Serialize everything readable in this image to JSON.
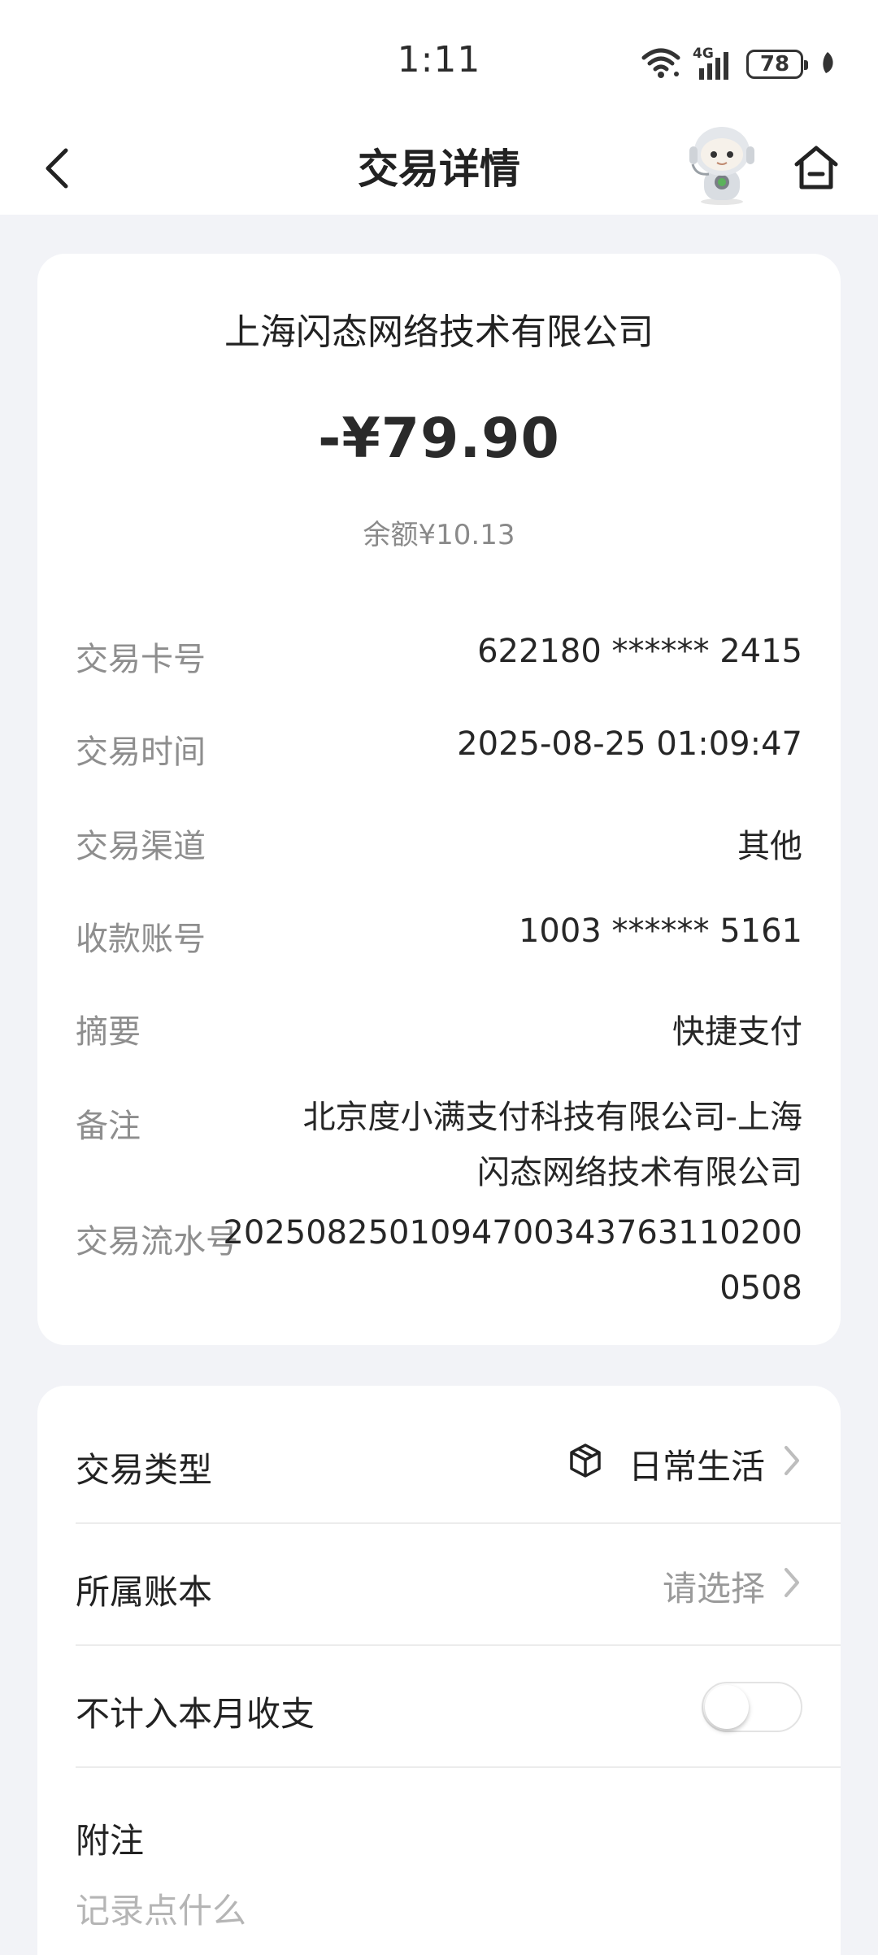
{
  "status_bar": {
    "time": "1:11",
    "network": "4G",
    "battery": "78"
  },
  "header": {
    "title": "交易详情"
  },
  "transaction": {
    "merchant": "上海闪态网络技术有限公司",
    "amount": "-¥79.90",
    "balance": "余额¥10.13",
    "details": [
      {
        "label": "交易卡号",
        "value": "622180 ****** 2415"
      },
      {
        "label": "交易时间",
        "value": "2025-08-25 01:09:47"
      },
      {
        "label": "交易渠道",
        "value": "其他"
      },
      {
        "label": "收款账号",
        "value": "1003 ****** 5161"
      },
      {
        "label": "摘要",
        "value": "快捷支付"
      },
      {
        "label": "备注",
        "value_line1": "北京度小满支付科技有限公司-上海",
        "value_line2": "闪态网络技术有限公司"
      },
      {
        "label": "交易流水号",
        "value_line1": "2025082501094700343763110200",
        "value_line2": "0508"
      }
    ]
  },
  "settings": {
    "type_label": "交易类型",
    "type_value": "日常生活",
    "type_icon": "box-icon",
    "book_label": "所属账本",
    "book_placeholder": "请选择",
    "exclude_label": "不计入本月收支",
    "exclude_on": false,
    "note_label": "附注",
    "note_placeholder": "记录点什么"
  },
  "colors": {
    "page_bg": "#f2f3f7",
    "card_bg": "#ffffff",
    "label_gray": "#8e8e8e"
  }
}
